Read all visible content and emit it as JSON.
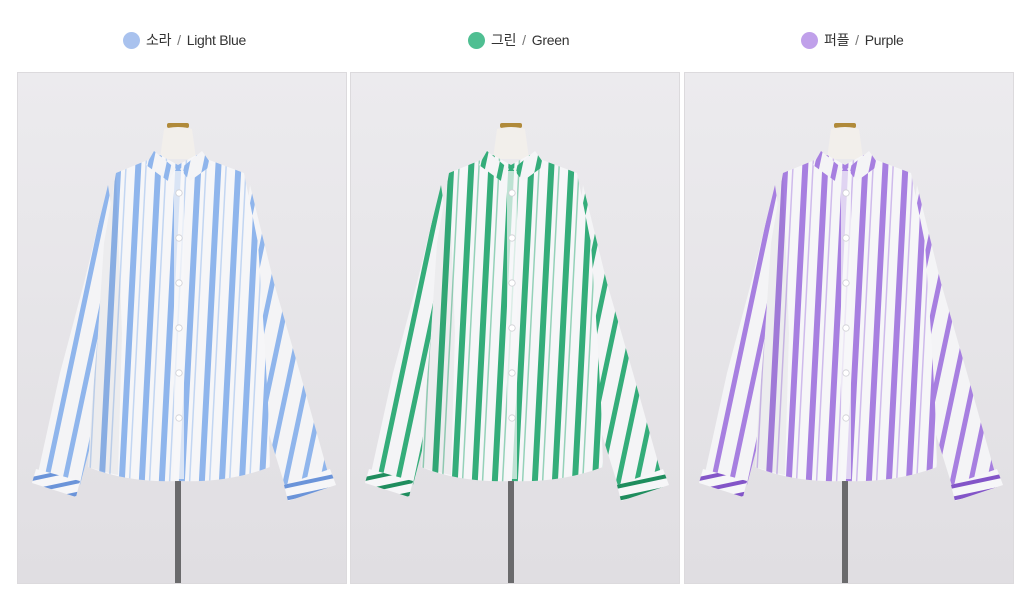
{
  "colors": [
    {
      "ko": "소라",
      "sep": "/",
      "en": "Light Blue",
      "dot": "#a9c2ee",
      "stripe": "#8fb5ec",
      "dark": "#6b94d9"
    },
    {
      "ko": "그린",
      "sep": "/",
      "en": "Green",
      "dot": "#4fbf92",
      "stripe": "#34ad7a",
      "dark": "#1f8d5e"
    },
    {
      "ko": "퍼플",
      "sep": "/",
      "en": "Purple",
      "dot": "#c0a0ea",
      "stripe": "#a77fe0",
      "dark": "#8355c8"
    }
  ]
}
